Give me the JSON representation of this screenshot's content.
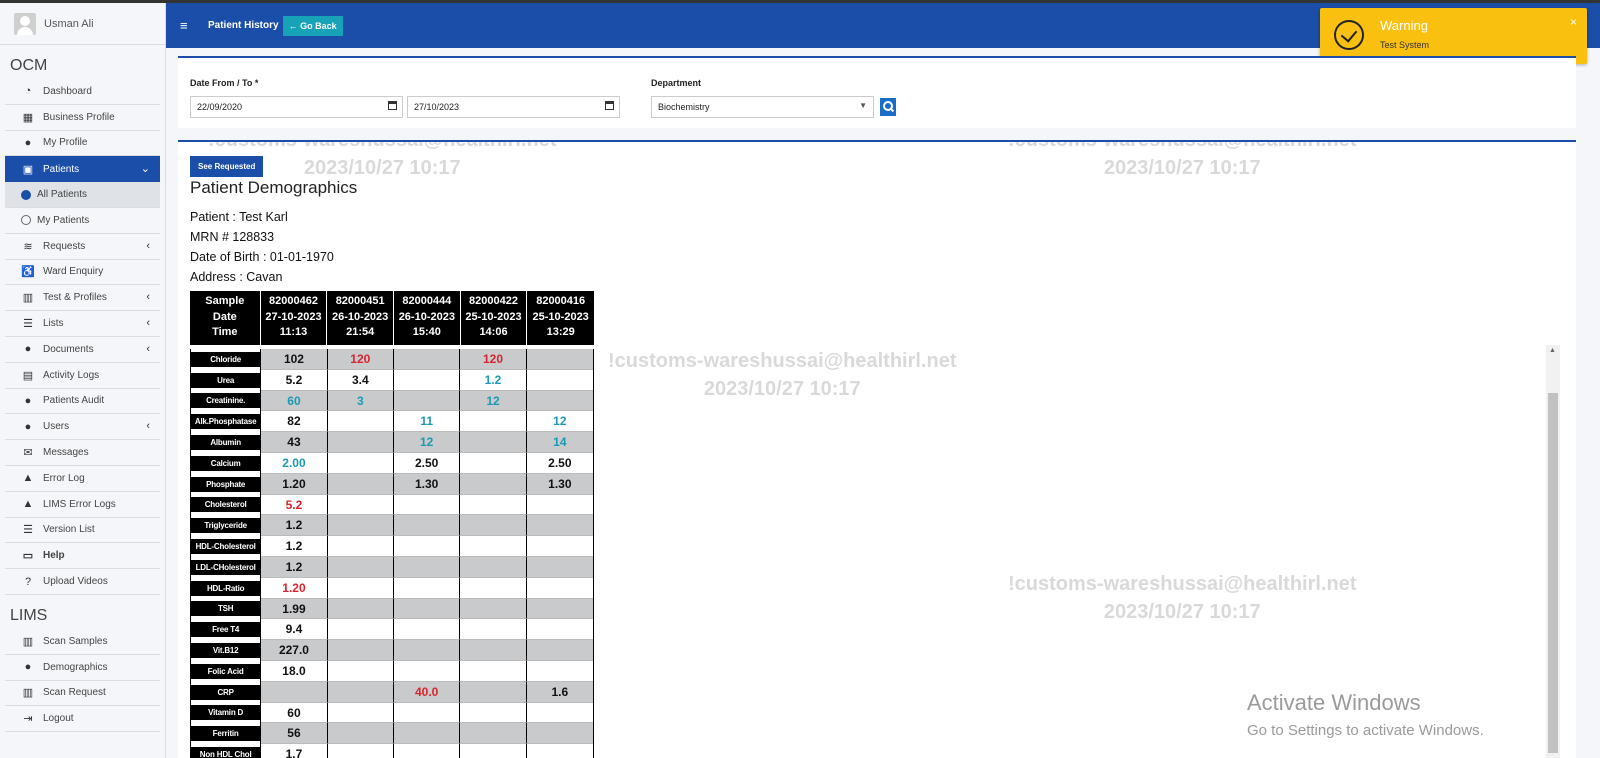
{
  "user": {
    "name": "Usman Ali"
  },
  "sidebar": {
    "ocm_title": "OCM",
    "lims_title": "LIMS",
    "ocm_items": [
      {
        "label": "Dashboard",
        "icon": "dashboard-icon"
      },
      {
        "label": "Business Profile",
        "icon": "building-icon"
      },
      {
        "label": "My Profile",
        "icon": "user-icon"
      },
      {
        "label": "Patients",
        "icon": "id-card-icon"
      },
      {
        "label": "All Patients",
        "icon": "radio-filled-icon"
      },
      {
        "label": "My Patients",
        "icon": "radio-empty-icon"
      },
      {
        "label": "Requests",
        "icon": "database-icon"
      },
      {
        "label": "Ward Enquiry",
        "icon": "wheelchair-icon"
      },
      {
        "label": "Test & Profiles",
        "icon": "columns-icon"
      },
      {
        "label": "Lists",
        "icon": "list-icon"
      },
      {
        "label": "Documents",
        "icon": "users-icon"
      },
      {
        "label": "Activity Logs",
        "icon": "archive-icon"
      },
      {
        "label": "Patients Audit",
        "icon": "users-icon"
      },
      {
        "label": "Users",
        "icon": "users-icon"
      },
      {
        "label": "Messages",
        "icon": "envelope-icon"
      },
      {
        "label": "Error Log",
        "icon": "warning-icon"
      },
      {
        "label": "LIMS Error Logs",
        "icon": "warning-icon"
      },
      {
        "label": "Version List",
        "icon": "list-icon"
      },
      {
        "label": "Help",
        "icon": "keyboard-icon"
      },
      {
        "label": "Upload Videos",
        "icon": "question-circle-icon"
      }
    ],
    "lims_items": [
      {
        "label": "Scan Samples",
        "icon": "barcode-icon"
      },
      {
        "label": "Demographics",
        "icon": "user-cog-icon"
      },
      {
        "label": "Scan Request",
        "icon": "barcode-icon"
      },
      {
        "label": "Logout",
        "icon": "logout-icon"
      }
    ]
  },
  "header": {
    "title": "Patient History",
    "go_back": "Go Back"
  },
  "toast": {
    "title": "Warning",
    "message": "Test System",
    "close": "×"
  },
  "filter": {
    "date_label": "Date From / To *",
    "date_from": "22/09/2020",
    "date_to": "27/10/2023",
    "department_label": "Department",
    "department_value": "Biochemistry"
  },
  "content": {
    "see_requested": "See Requested",
    "demographics_title": "Patient Demographics",
    "patient": "Patient : Test Karl",
    "mrn": "MRN # 128833",
    "dob": "Date of Birth : 01-01-1970",
    "address": "Address : Cavan"
  },
  "watermark": {
    "line1": "!customs-wareshussai@healthirl.net",
    "line2": "2023/10/27 10:17"
  },
  "results": {
    "header_label": [
      "Sample",
      "Date",
      "Time"
    ],
    "samples": [
      {
        "id": "82000462",
        "date": "27-10-2023",
        "time": "11:13"
      },
      {
        "id": "82000451",
        "date": "26-10-2023",
        "time": "21:54"
      },
      {
        "id": "82000444",
        "date": "26-10-2023",
        "time": "15:40"
      },
      {
        "id": "82000422",
        "date": "25-10-2023",
        "time": "14:06"
      },
      {
        "id": "82000416",
        "date": "25-10-2023",
        "time": "13:29"
      }
    ],
    "rows": [
      {
        "test": "Chloride",
        "values": [
          "102",
          "120",
          "",
          "120",
          ""
        ],
        "colors": [
          "",
          "red",
          "",
          "red",
          ""
        ]
      },
      {
        "test": "Urea",
        "values": [
          "5.2",
          "3.4",
          "",
          "1.2",
          ""
        ],
        "colors": [
          "",
          "",
          "",
          "blue",
          ""
        ]
      },
      {
        "test": "Creatinine.",
        "values": [
          "60",
          "3",
          "",
          "12",
          ""
        ],
        "colors": [
          "blue",
          "blue",
          "",
          "blue",
          ""
        ]
      },
      {
        "test": "Alk.Phosphatase",
        "values": [
          "82",
          "",
          "11",
          "",
          "12"
        ],
        "colors": [
          "",
          "",
          "blue",
          "",
          "blue"
        ]
      },
      {
        "test": "Albumin",
        "values": [
          "43",
          "",
          "12",
          "",
          "14"
        ],
        "colors": [
          "",
          "",
          "blue",
          "",
          "blue"
        ]
      },
      {
        "test": "Calcium",
        "values": [
          "2.00",
          "",
          "2.50",
          "",
          "2.50"
        ],
        "colors": [
          "blue",
          "",
          "",
          "",
          ""
        ]
      },
      {
        "test": "Phosphate",
        "values": [
          "1.20",
          "",
          "1.30",
          "",
          "1.30"
        ],
        "colors": [
          "",
          "",
          "",
          "",
          ""
        ]
      },
      {
        "test": "Cholesterol",
        "values": [
          "5.2",
          "",
          "",
          "",
          ""
        ],
        "colors": [
          "red",
          "",
          "",
          "",
          ""
        ]
      },
      {
        "test": "Triglyceride",
        "values": [
          "1.2",
          "",
          "",
          "",
          ""
        ],
        "colors": [
          "",
          "",
          "",
          "",
          ""
        ]
      },
      {
        "test": "HDL-Cholesterol",
        "values": [
          "1.2",
          "",
          "",
          "",
          ""
        ],
        "colors": [
          "",
          "",
          "",
          "",
          ""
        ]
      },
      {
        "test": "LDL-CHolesterol",
        "values": [
          "1.2",
          "",
          "",
          "",
          ""
        ],
        "colors": [
          "",
          "",
          "",
          "",
          ""
        ]
      },
      {
        "test": "HDL-Ratio",
        "values": [
          "1.20",
          "",
          "",
          "",
          ""
        ],
        "colors": [
          "red",
          "",
          "",
          "",
          ""
        ]
      },
      {
        "test": "TSH",
        "values": [
          "1.99",
          "",
          "",
          "",
          ""
        ],
        "colors": [
          "",
          "",
          "",
          "",
          ""
        ]
      },
      {
        "test": "Free T4",
        "values": [
          "9.4",
          "",
          "",
          "",
          ""
        ],
        "colors": [
          "",
          "",
          "",
          "",
          ""
        ]
      },
      {
        "test": "Vit.B12",
        "values": [
          "227.0",
          "",
          "",
          "",
          ""
        ],
        "colors": [
          "",
          "",
          "",
          "",
          ""
        ]
      },
      {
        "test": "Folic Acid",
        "values": [
          "18.0",
          "",
          "",
          "",
          ""
        ],
        "colors": [
          "",
          "",
          "",
          "",
          ""
        ]
      },
      {
        "test": "CRP",
        "values": [
          "",
          "",
          "40.0",
          "",
          "1.6"
        ],
        "colors": [
          "",
          "",
          "red",
          "",
          ""
        ]
      },
      {
        "test": "Vitamin D",
        "values": [
          "60",
          "",
          "",
          "",
          ""
        ],
        "colors": [
          "",
          "",
          "",
          "",
          ""
        ]
      },
      {
        "test": "Ferritin",
        "values": [
          "56",
          "",
          "",
          "",
          ""
        ],
        "colors": [
          "",
          "",
          "",
          "",
          ""
        ]
      },
      {
        "test": "Non HDL Chol",
        "values": [
          "1.7",
          "",
          "",
          "",
          ""
        ],
        "colors": [
          "",
          "",
          "",
          "",
          ""
        ]
      }
    ]
  },
  "activate": {
    "title": "Activate Windows",
    "subtitle": "Go to Settings to activate Windows."
  },
  "colors": {
    "primary": "#1a4ea8",
    "toast": "#f9c00f",
    "red": "#d9242f",
    "blue": "#1b9ab5",
    "goback": "#17a2b8"
  }
}
